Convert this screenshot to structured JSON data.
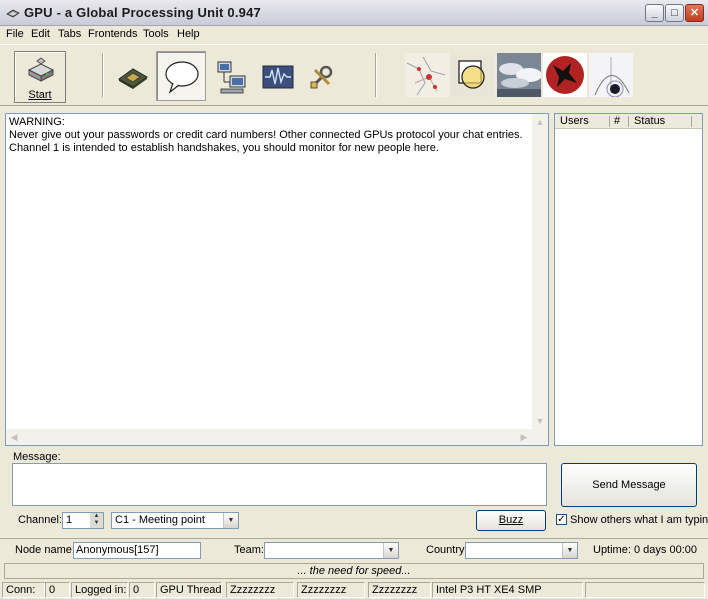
{
  "window": {
    "title": "GPU - a Global Processing Unit 0.947",
    "min_glyph": "_",
    "max_glyph": "□",
    "close_glyph": "✕"
  },
  "menu": [
    {
      "label": "File"
    },
    {
      "label": "Edit"
    },
    {
      "label": "Tabs"
    },
    {
      "label": "Frontends"
    },
    {
      "label": "Tools"
    },
    {
      "label": "Help"
    }
  ],
  "toolbar": {
    "start_label": "Start",
    "buttons": [
      {
        "icon": "cpu-chip-icon"
      },
      {
        "icon": "chat-bubble-icon",
        "pressed": true
      },
      {
        "icon": "network-computers-icon"
      },
      {
        "icon": "waveform-monitor-icon"
      },
      {
        "icon": "tools-wrench-icon"
      }
    ],
    "frontends": [
      {
        "icon": "map-frontend-icon"
      },
      {
        "icon": "shapes-frontend-icon"
      },
      {
        "icon": "clouds-frontend-icon"
      },
      {
        "icon": "bird-logo-frontend-icon"
      },
      {
        "icon": "orbit-frontend-icon"
      }
    ]
  },
  "chat": {
    "lines": [
      "WARNING:",
      "Never give out your passwords or credit card numbers! Other connected GPUs protocol your chat entries.",
      "Channel 1 is intended to establish handshakes, you should monitor for new people here."
    ]
  },
  "users": {
    "columns": [
      "Users",
      "#",
      "Status"
    ]
  },
  "message": {
    "label": "Message:",
    "value": "",
    "send_label": "Send Message"
  },
  "channel": {
    "label": "Channel:",
    "number": "1",
    "selected": "C1 - Meeting point",
    "buzz_label": "Buzz",
    "show_typing_label": "Show others what I am typing",
    "show_typing_checked": true
  },
  "node": {
    "name_label": "Node name:",
    "name_value": "Anonymous[157]",
    "team_label": "Team:",
    "team_value": "",
    "country_label": "Country:",
    "country_value": "",
    "uptime_label": "Uptime:",
    "uptime_value": "0 days 00:00"
  },
  "motto": "... the need for speed...",
  "status": {
    "conn_label": "Conn:",
    "conn_value": "0",
    "logged_label": "Logged in:",
    "logged_value": "0",
    "threads_label": "GPU Threads",
    "threads": [
      "Zzzzzzzz",
      "Zzzzzzzz",
      "Zzzzzzzz"
    ],
    "cpu": "Intel P3 HT XE4 SMP"
  }
}
